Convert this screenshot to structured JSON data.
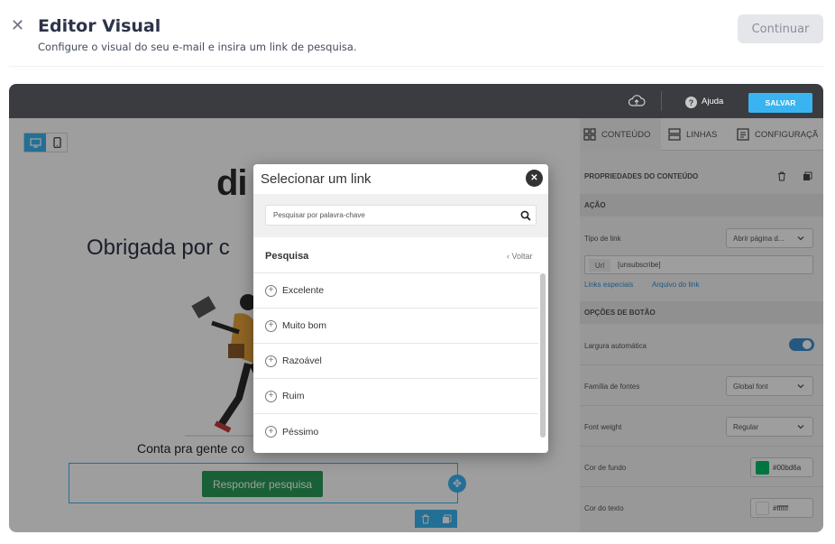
{
  "header": {
    "title": "Editor Visual",
    "subtitle": "Configure o visual do seu e-mail e insira um link de pesquisa.",
    "continue_label": "Continuar"
  },
  "topbar": {
    "help_label": "Ajuda",
    "save_label": "SALVAR"
  },
  "canvas": {
    "logo_fragment": "di",
    "thanks_text": "Obrigada por c",
    "share_text": "Conta pra gente co",
    "button_label": "Responder pesquisa"
  },
  "panel": {
    "tabs": [
      "CONTEÚDO",
      "LINHAS",
      "CONFIGURAÇÃ"
    ],
    "props_title": "PROPRIEDADES DO CONTEÚDO",
    "section_action": "AÇÃO",
    "link_type_label": "Tipo de link",
    "link_type_value": "Abrir página d...",
    "url_tag": "Url",
    "url_value": "[unsubscribe]",
    "special_links": "Links especiais",
    "file_link": "Arquivo do link",
    "section_button": "OPÇÕES DE BOTÃO",
    "auto_width_label": "Largura automática",
    "auto_width_on": true,
    "font_family_label": "Família de fontes",
    "font_family_value": "Global font",
    "font_weight_label": "Font weight",
    "font_weight_value": "Regular",
    "bg_color_label": "Cor de fundo",
    "bg_color_value": "#00bd6a",
    "text_color_label": "Cor do texto",
    "text_color_value": "#ffffff"
  },
  "modal": {
    "title": "Selecionar um link",
    "search_placeholder": "Pesquisar por palavra-chave",
    "category": "Pesquisa",
    "back_label": "‹ Voltar",
    "items": [
      "Excelente",
      "Muito bom",
      "Razoável",
      "Ruim",
      "Péssimo"
    ]
  },
  "colors": {
    "accent": "#3ab4f0",
    "button_green": "#2a9c57",
    "topbar": "#3a3c40"
  }
}
